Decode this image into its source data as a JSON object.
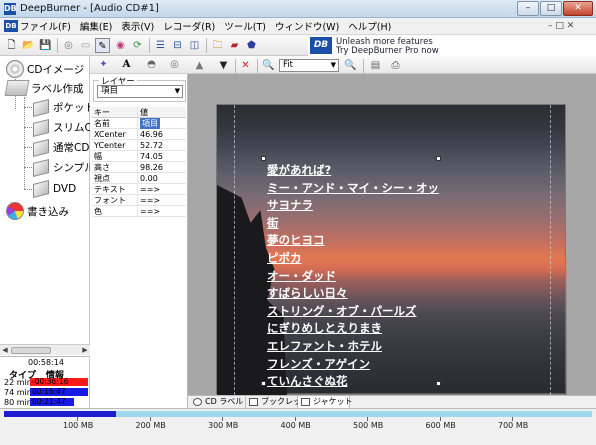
{
  "window": {
    "title": "DeepBurner - [Audio CD#1]",
    "app_icon": "DB"
  },
  "menu": [
    "ファイル(F)",
    "編集(E)",
    "表示(V)",
    "レコーダ(R)",
    "ツール(T)",
    "ウィンドウ(W)",
    "ヘルプ(H)"
  ],
  "promo": {
    "line1": "Unleash more features",
    "line2": "Try DeepBurner Pro now",
    "logo": "DB"
  },
  "tree": {
    "root": "CDイメージ",
    "label_node": "ラベル作成",
    "children": [
      "ポケットC",
      "スリムCD",
      "通常CD",
      "シンプル",
      "DVD"
    ],
    "burn": "書き込み"
  },
  "info": {
    "time": "00:58:14",
    "col_type": "タイプ",
    "col_info": "情報",
    "rows": [
      {
        "min": "22 min",
        "value": "-00:36:16",
        "color": "#ff1a1a",
        "fill": 1.0
      },
      {
        "min": "74 min",
        "value": "00:15:47",
        "color": "#1a1ae6",
        "fill": 1.0
      },
      {
        "min": "80 min",
        "value": "00:21:47",
        "color": "#1a1ae6",
        "fill": 0.75
      }
    ]
  },
  "layer": {
    "legend": "レイヤー",
    "select_value": "項目",
    "head_key": "キー",
    "head_value": "値",
    "properties": [
      {
        "key": "名前",
        "value": "項目",
        "selected": true
      },
      {
        "key": "XCenter",
        "value": "46.96"
      },
      {
        "key": "YCenter",
        "value": "52.72"
      },
      {
        "key": "幅",
        "value": "74.05"
      },
      {
        "key": "高さ",
        "value": "98.26"
      },
      {
        "key": "視点",
        "value": "0.00"
      },
      {
        "key": "テキスト",
        "value": "==>"
      },
      {
        "key": "フォント",
        "value": "==>"
      },
      {
        "key": "色",
        "value": "==>"
      }
    ]
  },
  "zoom": {
    "value": "Fit"
  },
  "tracks": [
    "愛があれば?",
    "ミー・アンド・マイ・シー・オッ",
    "サヨナラ",
    "街",
    "夢のヒヨコ",
    "ピポカ",
    "オー・ダッド",
    "すばらしい日々",
    "ストリング・オブ・パールズ",
    "にぎりめしとえりまき",
    "エレファント・ホテル",
    "フレンズ・アゲイン",
    "ていんさぐぬ花"
  ],
  "tabs": [
    "CD ラベル",
    "ブックレット",
    "ジャケット"
  ],
  "active_tab": 2,
  "capacity": {
    "used_fraction": 0.19,
    "ticks": [
      "100 MB",
      "200 MB",
      "300 MB",
      "400 MB",
      "500 MB",
      "600 MB",
      "700 MB"
    ]
  }
}
